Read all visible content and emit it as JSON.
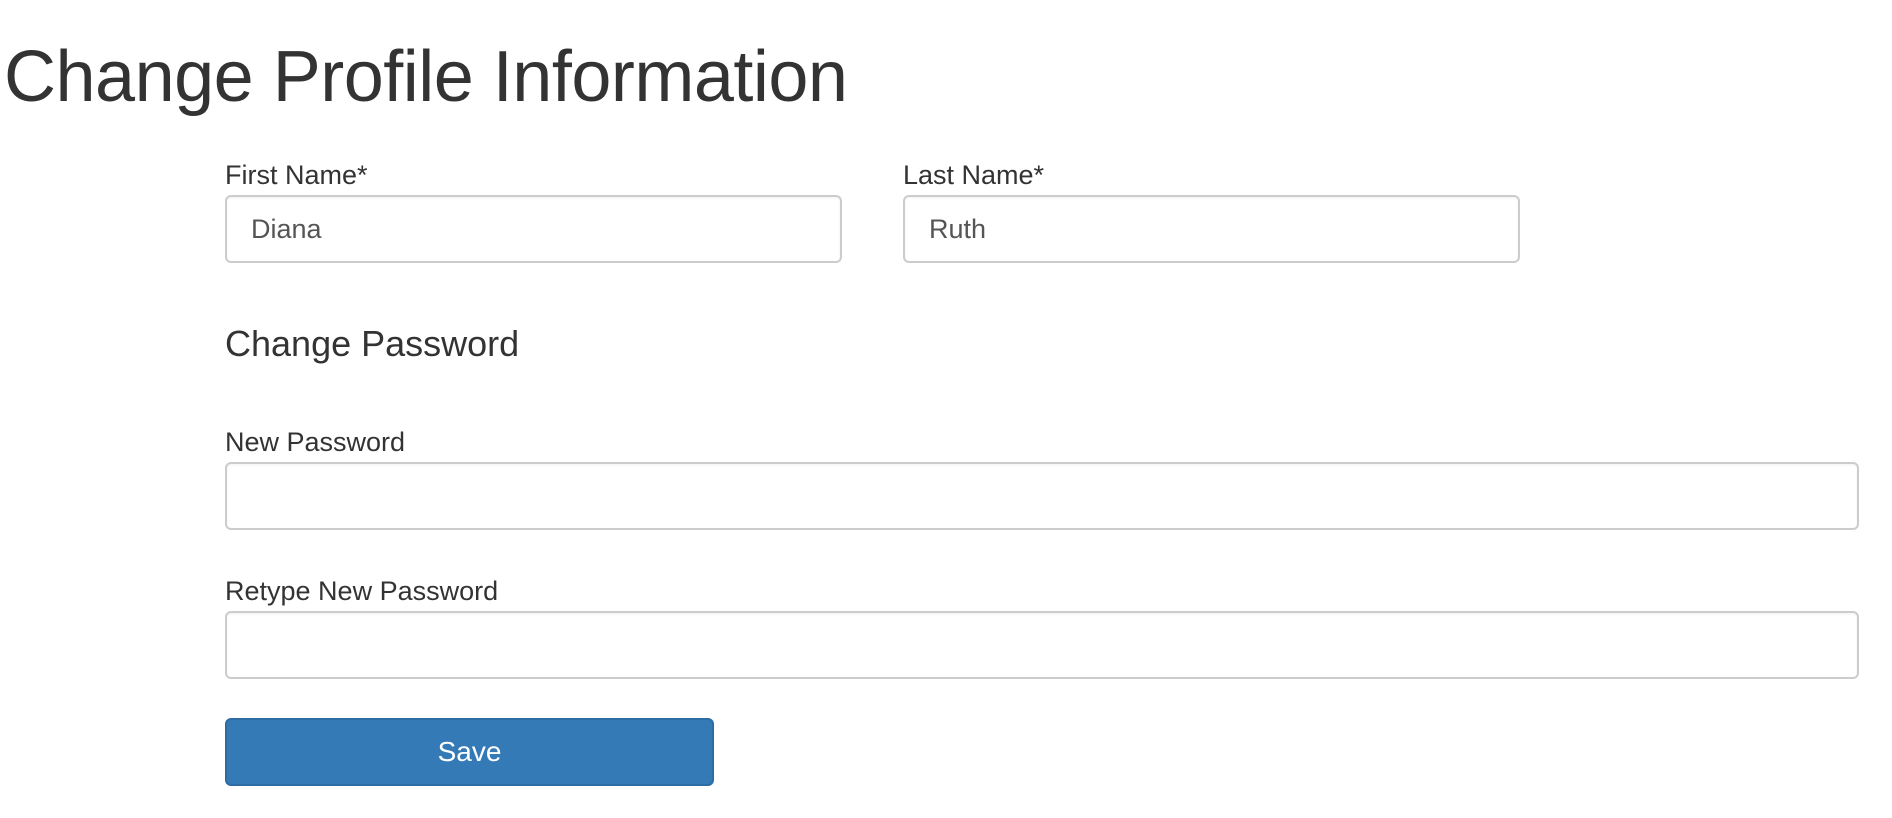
{
  "page": {
    "title": "Change Profile Information"
  },
  "profile": {
    "first_name": {
      "label": "First Name*",
      "value": "Diana"
    },
    "last_name": {
      "label": "Last Name*",
      "value": "Ruth"
    }
  },
  "password_section": {
    "heading": "Change Password",
    "new_password": {
      "label": "New Password",
      "value": ""
    },
    "retype_password": {
      "label": "Retype New Password",
      "value": ""
    }
  },
  "actions": {
    "save_label": "Save"
  },
  "colors": {
    "primary_button": "#337ab7",
    "text": "#333333",
    "input_border": "#cccccc"
  }
}
